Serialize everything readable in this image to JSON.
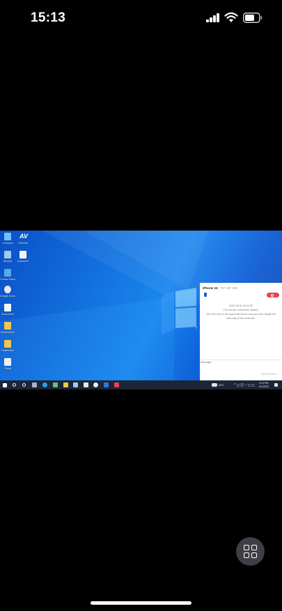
{
  "status_bar": {
    "time": "15:13",
    "icons": [
      "cellular-signal-icon",
      "wifi-icon",
      "battery-icon"
    ]
  },
  "desktop": {
    "icons": [
      {
        "name": "desktop-icon-1",
        "label": "Computer"
      },
      {
        "name": "desktop-icon-2",
        "label": "AirDroid"
      },
      {
        "name": "desktop-icon-3",
        "label": "Recycle"
      },
      {
        "name": "desktop-icon-4",
        "label": "Document"
      },
      {
        "name": "desktop-icon-5",
        "label": "Control Panel"
      },
      {
        "name": "desktop-icon-6",
        "label": "Google Chrome"
      },
      {
        "name": "desktop-icon-7",
        "label": "Documents"
      },
      {
        "name": "desktop-icon-8",
        "label": "Screenshots"
      },
      {
        "name": "desktop-icon-9",
        "label": "Downloads"
      },
      {
        "name": "desktop-icon-10",
        "label": "Setup"
      }
    ],
    "wallpaper_colors": {
      "top": "#0a4fc7",
      "mid": "#1a86ee",
      "bottom": "#0a3ea8"
    }
  },
  "remote_panel": {
    "device_name": "iPhone 15",
    "device_id": "7XF MF 409",
    "timestamp": "2022-06-01 15:11:52",
    "status_message": "The remote connection started.",
    "hint_line_1": "Click the icon in the upper left corner and you can change the",
    "hint_line_2": "authority of the controller.",
    "message_placeholder": "Message...",
    "send_label": "Send (Enter)",
    "colors": {
      "end_button": "#e8424f",
      "flag": "#1a5fd6"
    }
  },
  "taskbar": {
    "weather": "28°C",
    "time": "3:12 PM",
    "date": "6/1/2022"
  },
  "app_controls": {
    "grid_button_icon": "grid-icon"
  }
}
